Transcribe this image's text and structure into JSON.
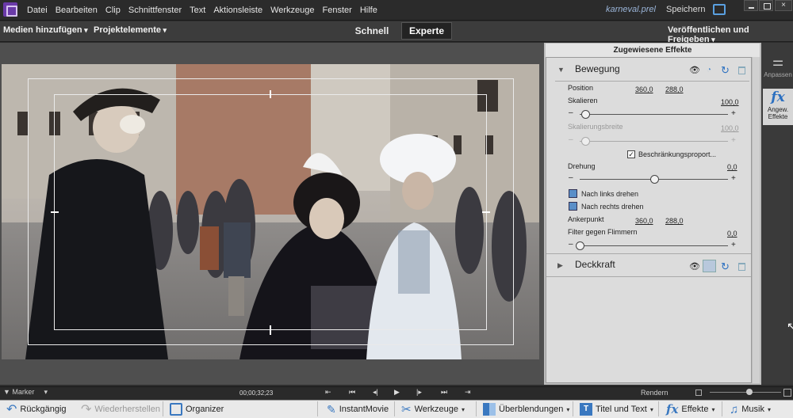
{
  "menubar": {
    "items": [
      "Datei",
      "Bearbeiten",
      "Clip",
      "Schnittfenster",
      "Text",
      "Aktionsleiste",
      "Werkzeuge",
      "Fenster",
      "Hilfe"
    ],
    "project_name": "karneval.prel",
    "save_label": "Speichern",
    "close_glyph": "×"
  },
  "modebar": {
    "add_media": "Medien hinzufügen",
    "project_assets": "Projektelemente",
    "quick": "Schnell",
    "expert": "Experte",
    "publish": "Veröffentlichen und Freigeben"
  },
  "effects_panel": {
    "title": "Zugewiesene Effekte",
    "motion": {
      "title": "Bewegung",
      "position_label": "Position",
      "position_x": "360,0",
      "position_y": "288,0",
      "scale_label": "Skalieren",
      "scale_value": "100,0",
      "scale_level": 0.04,
      "scale_width_label": "Skalierungsbreite",
      "scale_width_value": "100,0",
      "scale_width_level": 0.04,
      "constrain_label": "Beschränkungsproport...",
      "constrain_checked": true,
      "rotation_label": "Drehung",
      "rotation_value": "0,0",
      "rotation_level": 0.5,
      "rotate_left": "Nach links drehen",
      "rotate_right": "Nach rechts drehen",
      "anchor_label": "Ankerpunkt",
      "anchor_x": "360,0",
      "anchor_y": "288,0",
      "flicker_label": "Filter gegen Flimmern",
      "flicker_value": "0,0",
      "flicker_level": 0.0
    },
    "opacity": {
      "title": "Deckkraft"
    }
  },
  "sidepanel": {
    "adjust": "Anpassen",
    "applied_fx_line1": "Angew.",
    "applied_fx_line2": "Effekte"
  },
  "transport": {
    "marker": "Marker",
    "timecode": "00;00;32;23",
    "render": "Rendern"
  },
  "actionbar": {
    "undo": "Rückgängig",
    "redo": "Wiederherstellen",
    "organizer": "Organizer",
    "instant_movie": "InstantMovie",
    "tools": "Werkzeuge",
    "transitions": "Überblendungen",
    "titles": "Titel und Text",
    "effects": "Effekte",
    "music": "Musik"
  },
  "colors": {
    "accent": "#5aa0e0",
    "panel_bg": "#dcdcdc",
    "app_bg": "#2d2d2d"
  }
}
